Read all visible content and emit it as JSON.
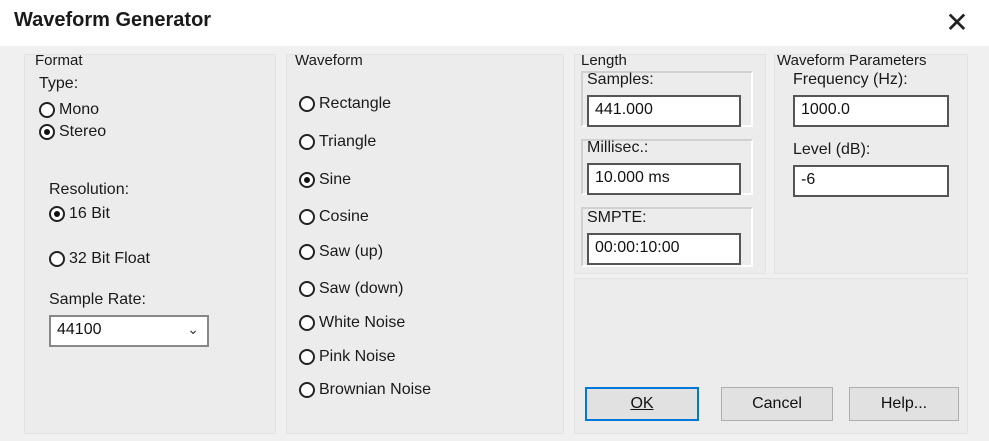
{
  "window": {
    "title": "Waveform Generator",
    "close_glyph": "✕"
  },
  "format": {
    "title": "Format",
    "type_label": "Type:",
    "type_options": [
      {
        "label": "Mono",
        "selected": false
      },
      {
        "label": "Stereo",
        "selected": true
      }
    ],
    "resolution_label": "Resolution:",
    "resolution_options": [
      {
        "label": "16 Bit",
        "selected": true
      },
      {
        "label": "32 Bit Float",
        "selected": false
      }
    ],
    "sample_rate_label": "Sample Rate:",
    "sample_rate_value": "44100"
  },
  "waveform": {
    "title": "Waveform",
    "options": [
      {
        "label": "Rectangle",
        "selected": false
      },
      {
        "label": "Triangle",
        "selected": false
      },
      {
        "label": "Sine",
        "selected": true
      },
      {
        "label": "Cosine",
        "selected": false
      },
      {
        "label": "Saw (up)",
        "selected": false
      },
      {
        "label": "Saw (down)",
        "selected": false
      },
      {
        "label": "White Noise",
        "selected": false
      },
      {
        "label": "Pink Noise",
        "selected": false
      },
      {
        "label": "Brownian Noise",
        "selected": false
      }
    ]
  },
  "length": {
    "title": "Length",
    "samples_label": "Samples:",
    "samples_value": "441.000",
    "millisec_label": "Millisec.:",
    "millisec_value": "10.000 ms",
    "smpte_label": "SMPTE:",
    "smpte_value": "00:00:10:00"
  },
  "parameters": {
    "title": "Waveform Parameters",
    "frequency_label": "Frequency (Hz):",
    "frequency_value": "1000.0",
    "level_label": "Level (dB):",
    "level_value": "-6"
  },
  "buttons": {
    "ok": "OK",
    "cancel": "Cancel",
    "help": "Help..."
  },
  "colors": {
    "accent": "#0078d7",
    "panel_bg": "#ececec"
  }
}
